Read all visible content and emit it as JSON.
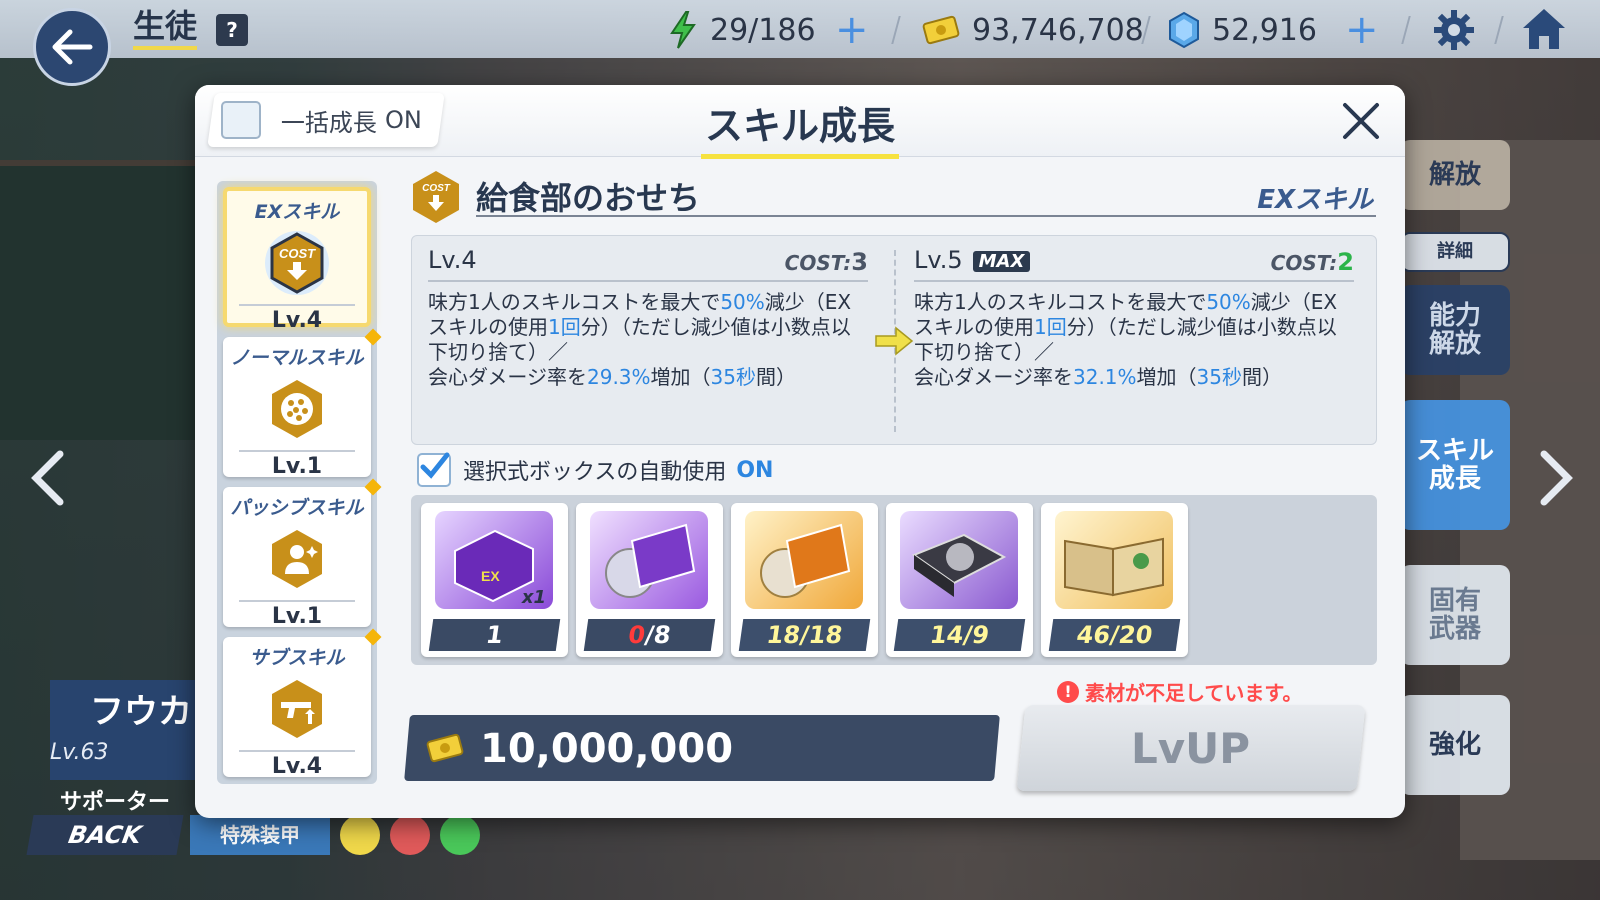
{
  "topbar": {
    "title": "生徒",
    "help_label": "?",
    "ap": "29/186",
    "credits": "93,746,708",
    "gems": "52,916"
  },
  "bottom": {
    "back_label": "BACK",
    "student_name": "フウカ",
    "student_level": "Lv.63",
    "role": "サポーター",
    "armor": "特殊装甲"
  },
  "right_menu": {
    "unlock": "解放",
    "detail": "詳細",
    "ability": "能力\n解放",
    "skill": "スキル\n成長",
    "weapon": "固有\n武器",
    "enhance": "強化"
  },
  "modal": {
    "title": "スキル成長",
    "bulk_label": "一括成長",
    "bulk_state": "ON",
    "tabs": [
      {
        "title": "EXスキル",
        "level": "Lv.4",
        "icon": "cost-down-icon"
      },
      {
        "title": "ノーマルスキル",
        "level": "Lv.1",
        "icon": "dotted-circle-icon"
      },
      {
        "title": "パッシブスキル",
        "level": "Lv.1",
        "icon": "person-sparkle-icon"
      },
      {
        "title": "サブスキル",
        "level": "Lv.4",
        "icon": "gun-up-icon"
      }
    ],
    "skill_name": "給食部のおせち",
    "skill_type": "EXスキル",
    "current": {
      "level": "Lv.4",
      "cost_label": "COST:",
      "cost": "3",
      "desc_a": "味方1人のスキルコストを最大で",
      "pct": "50%",
      "desc_b": "減少（EXスキルの使用",
      "times": "1回",
      "desc_c": "分）（ただし減少値は小数点以下切り捨て）／",
      "desc_d": "会心ダメージ率を",
      "crit": "29.3%",
      "desc_e": "増加（",
      "dur": "35秒",
      "desc_f": "間）"
    },
    "next": {
      "level": "Lv.5",
      "max_tag": "MAX",
      "cost_label": "COST:",
      "cost": "2",
      "desc_a": "味方1人のスキルコストを最大で",
      "pct": "50%",
      "desc_b": "減少（EXスキルの使用",
      "times": "1回",
      "desc_c": "分）（ただし減少値は小数点以下切り捨て）／",
      "desc_d": "会心ダメージ率を",
      "crit": "32.1%",
      "desc_e": "増加（",
      "dur": "35秒",
      "desc_f": "間）"
    },
    "auto_label": "選択式ボックスの自動使用",
    "auto_state": "ON",
    "materials": [
      {
        "count": "1",
        "tag": "x1"
      },
      {
        "count_have": "0",
        "count_need": "/8"
      },
      {
        "count": "18/18"
      },
      {
        "count": "14/9"
      },
      {
        "count": "46/20"
      }
    ],
    "price": "10,000,000",
    "warning": "素材が不足しています。",
    "lvup_label": "LvUP"
  }
}
